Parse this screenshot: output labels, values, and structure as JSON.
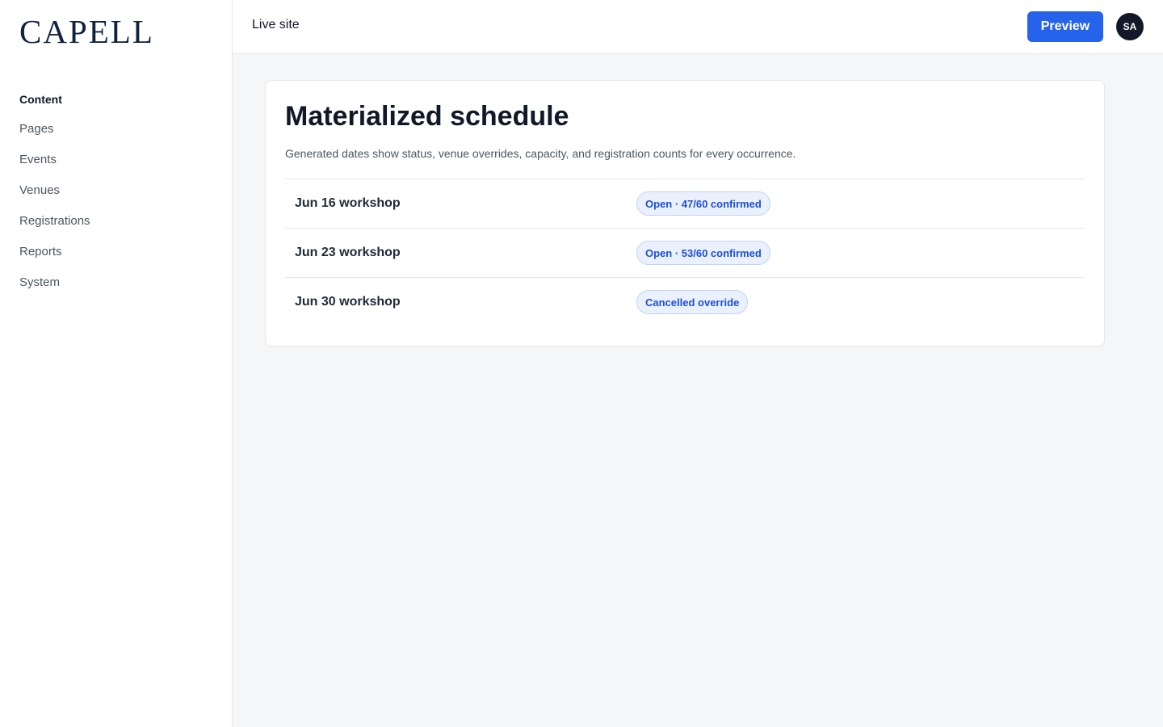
{
  "brand": {
    "logo_text": "CAPELL",
    "logo_color": "#0f2340"
  },
  "sidebar": {
    "heading": "Content",
    "items": [
      {
        "label": "Pages"
      },
      {
        "label": "Events"
      },
      {
        "label": "Venues"
      },
      {
        "label": "Registrations"
      },
      {
        "label": "Reports"
      },
      {
        "label": "System"
      }
    ]
  },
  "topbar": {
    "live_site_label": "Live site",
    "preview_label": "Preview",
    "avatar_initials": "SA",
    "accent_color": "#2563eb"
  },
  "main": {
    "title": "Materialized schedule",
    "description": "Generated dates show status, venue overrides, capacity, and registration counts for every occurrence.",
    "rows": [
      {
        "name": "Jun 16 workshop",
        "status": "Open · 47/60 confirmed"
      },
      {
        "name": "Jun 23 workshop",
        "status": "Open · 53/60 confirmed"
      },
      {
        "name": "Jun 30 workshop",
        "status": "Cancelled override"
      }
    ],
    "badge_color": "#1d4ed8",
    "badge_background": "#eaf1fd"
  }
}
